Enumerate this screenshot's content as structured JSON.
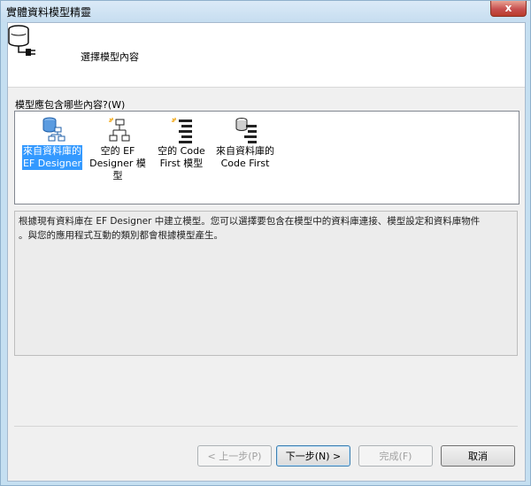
{
  "window": {
    "title": "實體資料模型精靈",
    "close_label": "x"
  },
  "header": {
    "title": "選擇模型內容"
  },
  "prompt": {
    "question": "模型應包含哪些內容?(W)"
  },
  "model_options": [
    {
      "line1": "來自資料庫的",
      "line2": "EF Designer",
      "line3": "",
      "icon": "database-diagram-icon",
      "selected": true
    },
    {
      "line1": "空的 EF",
      "line2": "Designer 模",
      "line3": "型",
      "icon": "empty-diagram-icon",
      "selected": false
    },
    {
      "line1": "空的 Code",
      "line2": "First 模型",
      "line3": "",
      "icon": "empty-code-first-icon",
      "selected": false
    },
    {
      "line1": "來自資料庫的",
      "line2": "Code First",
      "line3": "",
      "icon": "database-code-first-icon",
      "selected": false
    }
  ],
  "description": {
    "line1": "根據現有資料庫在 EF Designer 中建立模型。您可以選擇要包含在模型中的資料庫連接、模型設定和資料庫物件",
    "line2": "。與您的應用程式互動的類別都會根據模型產生。"
  },
  "buttons": {
    "prev": "< 上一步(P)",
    "next": "下一步(N) >",
    "finish": "完成(F)",
    "cancel": "取消"
  },
  "colors": {
    "selection": "#3399ff",
    "title_bar": "#c6ddf0",
    "close_button": "#c75050"
  }
}
